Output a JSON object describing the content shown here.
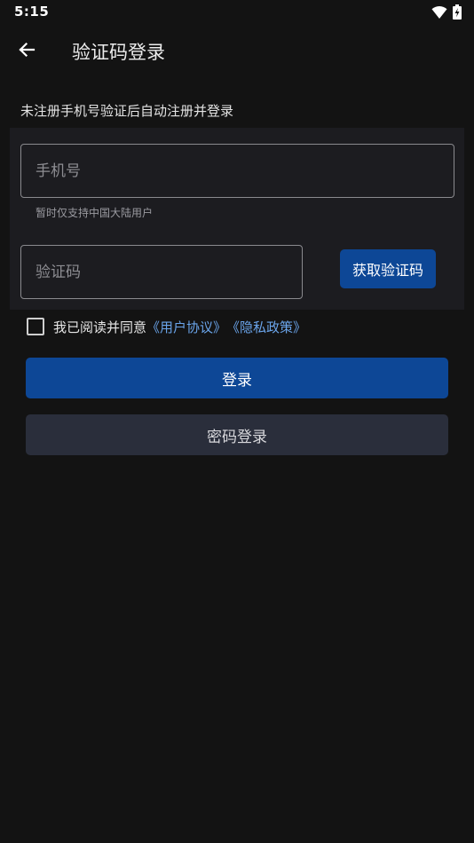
{
  "status_bar": {
    "time": "5:15",
    "icons": [
      "wifi-icon",
      "battery-charging-icon"
    ]
  },
  "header": {
    "back_icon": "arrow-left-icon",
    "title": "验证码登录"
  },
  "hint": "未注册手机号验证后自动注册并登录",
  "form": {
    "phone_placeholder": "手机号",
    "phone_helper": "暂时仅支持中国大陆用户",
    "code_placeholder": "验证码",
    "get_code_label": "获取验证码"
  },
  "agreement": {
    "checked": false,
    "text": "我已阅读并同意",
    "user_agreement": "《用户协议》",
    "privacy_policy": "《隐私政策》"
  },
  "actions": {
    "login_label": "登录",
    "password_login_label": "密码登录"
  },
  "colors": {
    "background": "#131313",
    "panel": "#1c1c20",
    "primary": "#0d4796",
    "secondary_button": "#2a2e3b",
    "link": "#6aa4ea"
  }
}
